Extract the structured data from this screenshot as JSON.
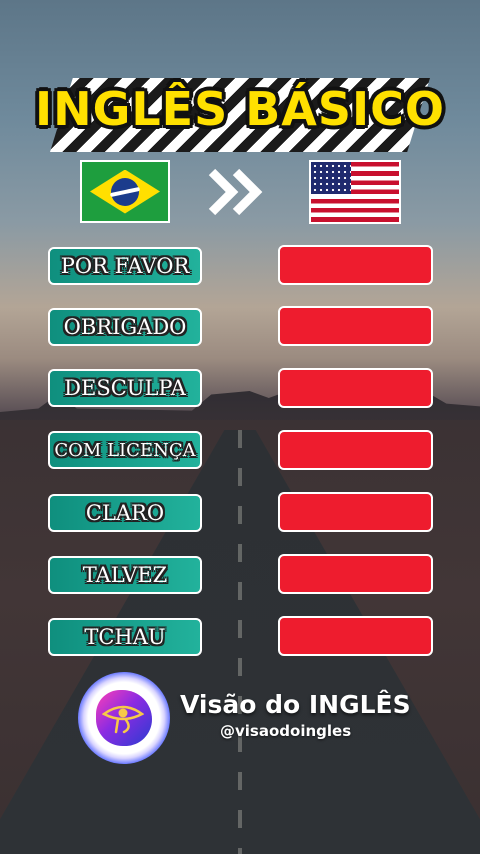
{
  "title": "INGLÊS BÁSICO",
  "flags": {
    "from": "brazil-flag",
    "to": "usa-flag"
  },
  "arrow_icon": "double-chevron-right-icon",
  "rows": [
    {
      "label": "POR FAVOR",
      "translation": ""
    },
    {
      "label": "OBRIGADO",
      "translation": ""
    },
    {
      "label": "DESCULPA",
      "translation": ""
    },
    {
      "label": "COM LICENÇA",
      "translation": ""
    },
    {
      "label": "CLARO",
      "translation": ""
    },
    {
      "label": "TALVEZ",
      "translation": ""
    },
    {
      "label": "TCHAU",
      "translation": ""
    }
  ],
  "brand": {
    "name": "Visão do INGLÊS",
    "handle": "@visaodoingles",
    "logo_icon": "eye-of-horus-logo"
  },
  "colors": {
    "title": "#ffe000",
    "label_box": "#1aa08e",
    "answer_box": "#ee1c2e"
  }
}
